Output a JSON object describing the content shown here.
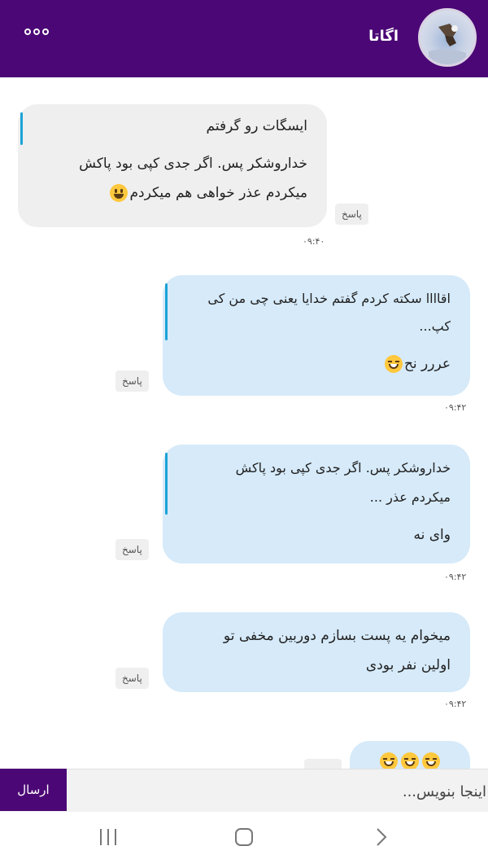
{
  "header": {
    "contact_name": "اگاتا",
    "menu_icon": "more-dots-icon",
    "avatar_icon": "profile-avatar"
  },
  "messages": [
    {
      "direction": "incoming",
      "quote": [
        "ایسگات رو گرفتم"
      ],
      "body": [
        "خداروشکر پس. اگر جدی کپی بود پاکش",
        "میکردم عذر خواهی هم میکردم"
      ],
      "emoji": "smile-emoji",
      "reply_label": "پاسخ",
      "time": "۰۹:۴۰"
    },
    {
      "direction": "outgoing",
      "quote": [
        "اقاااا سکته کردم گفتم خدایا یعنی چی من کی",
        "کپ..."
      ],
      "body": [
        "عررر نح"
      ],
      "emoji": "laugh-sweat-emoji",
      "reply_label": "پاسخ",
      "time": "۰۹:۴۲"
    },
    {
      "direction": "outgoing",
      "quote": [
        "خداروشکر پس. اگر جدی کپی بود پاکش",
        "میکردم عذر ..."
      ],
      "body": [
        "وای نه"
      ],
      "reply_label": "پاسخ",
      "time": "۰۹:۴۲"
    },
    {
      "direction": "outgoing",
      "body": [
        "میخوام یه پست بسازم دوربین مخفی تو",
        "اولین نفر بودی"
      ],
      "reply_label": "پاسخ",
      "time": "۰۹:۴۲"
    },
    {
      "direction": "outgoing",
      "emojis": [
        "rofl-emoji",
        "rofl-emoji",
        "rofl-emoji",
        "rofl-emoji"
      ]
    }
  ],
  "composer": {
    "placeholder": "اینجا بنویس...",
    "send_label": "ارسال"
  },
  "navbar": {
    "recents_icon": "recent-apps-icon",
    "home_icon": "home-icon",
    "back_icon": "back-icon"
  },
  "colors": {
    "header": "#4b0775",
    "incoming_bubble": "#efefef",
    "outgoing_bubble": "#d6eaf9",
    "quote_bar": "#1ba3d6"
  }
}
